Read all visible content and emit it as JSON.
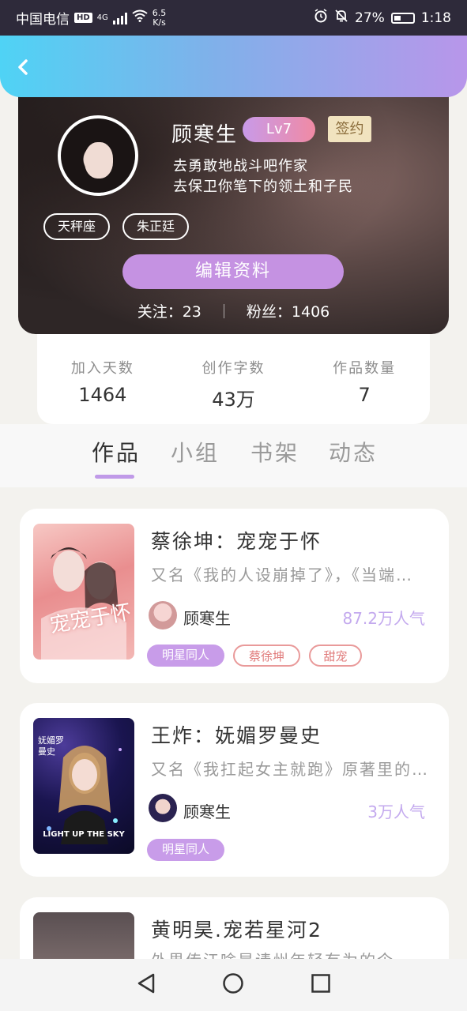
{
  "status_bar": {
    "carrier": "中国电信",
    "hd": "HD",
    "network": "4G",
    "speed_value": "6.5",
    "speed_unit": "K/s",
    "battery": "27%",
    "time": "1:18"
  },
  "profile": {
    "name": "顾寒生",
    "level": "Lv7",
    "signed_badge": "签约",
    "bio_line1": "去勇敢地战斗吧作家",
    "bio_line2": "去保卫你笔下的领土和子民",
    "tags": [
      "天秤座",
      "朱正廷"
    ],
    "edit_button": "编辑资料",
    "following_label": "关注：",
    "following_count": "23",
    "fans_label": "粉丝：",
    "fans_count": "1406"
  },
  "stats": [
    {
      "label": "加入天数",
      "value": "1464"
    },
    {
      "label": "创作字数",
      "value": "43万"
    },
    {
      "label": "作品数量",
      "value": "7"
    }
  ],
  "tabs": [
    "作品",
    "小组",
    "书架",
    "动态"
  ],
  "works": [
    {
      "title": "蔡徐坤：宠宠于怀",
      "alias": "又名《我的人设崩掉了》，《当端…",
      "author": "顾寒生",
      "popularity": "87.2万人气",
      "tags": [
        "明星同人",
        "蔡徐坤",
        "甜宠"
      ],
      "cover_text": "宠宠于怀"
    },
    {
      "title": "王炸：妩媚罗曼史",
      "alias": "又名《我扛起女主就跑》原著里的…",
      "author": "顾寒生",
      "popularity": "3万人气",
      "tags": [
        "明星同人"
      ],
      "cover_text": "LIGHT UP THE SKY",
      "cover_side": "妩媚罗曼史"
    },
    {
      "title": "黄明昊.宠若星河2",
      "alias": "外界传江啥是请州年轻有为的企"
    }
  ],
  "colors": {
    "accent_purple": "#c592e2",
    "header_gradient_start": "#4fd3f5",
    "header_gradient_end": "#b896ea"
  }
}
